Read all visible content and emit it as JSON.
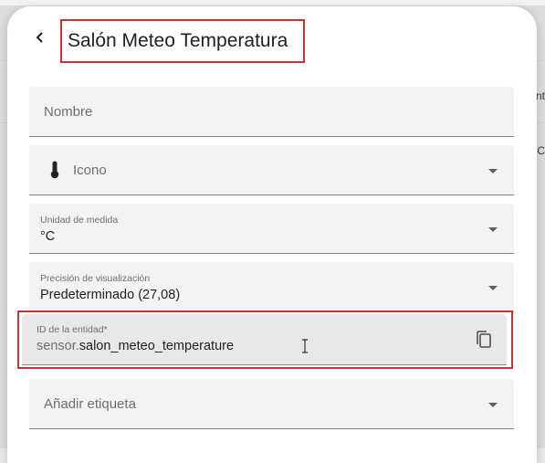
{
  "dialog": {
    "title": "Salón Meteo Temperatura",
    "back_icon": "chevron-left-icon"
  },
  "fields": {
    "nombre": {
      "placeholder": "Nombre"
    },
    "icono": {
      "placeholder": "Icono",
      "icon": "thermometer-icon"
    },
    "unidad": {
      "label": "Unidad de medida",
      "value": "°C"
    },
    "precision": {
      "label": "Precisión de visualización",
      "value": "Predeterminado (27,08)"
    },
    "entity_id": {
      "label": "ID de la entidad*",
      "prefix": "sensor.",
      "value": "salon_meteo_temperature",
      "copy_icon": "copy-icon"
    },
    "etiqueta": {
      "placeholder": "Añadir etiqueta"
    }
  },
  "background": {
    "peek1": "nt",
    "peek2": "MC"
  },
  "colors": {
    "highlight": "#d32f2f",
    "field_bg": "#f3f3f3",
    "focused_field_bg": "#e8e8e8"
  }
}
